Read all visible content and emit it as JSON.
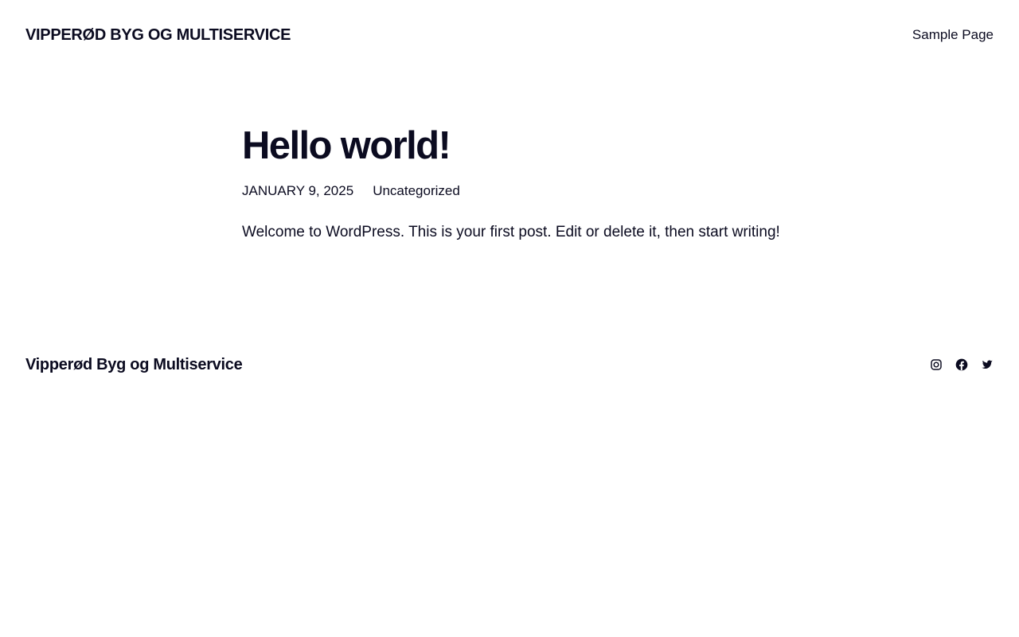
{
  "header": {
    "site_title": "Vipperød Byg og Multiservice",
    "nav": [
      {
        "label": "Sample Page"
      }
    ]
  },
  "post": {
    "title": "Hello world!",
    "date": "January 9, 2025",
    "category": "Uncategorized",
    "content": "Welcome to WordPress. This is your first post. Edit or delete it, then start writing!"
  },
  "footer": {
    "site_title": "Vipperød Byg og Multiservice",
    "social": [
      {
        "icon": "instagram-icon"
      },
      {
        "icon": "facebook-icon"
      },
      {
        "icon": "twitter-icon"
      }
    ]
  },
  "colors": {
    "text": "#0b0b20",
    "background": "#ffffff"
  }
}
